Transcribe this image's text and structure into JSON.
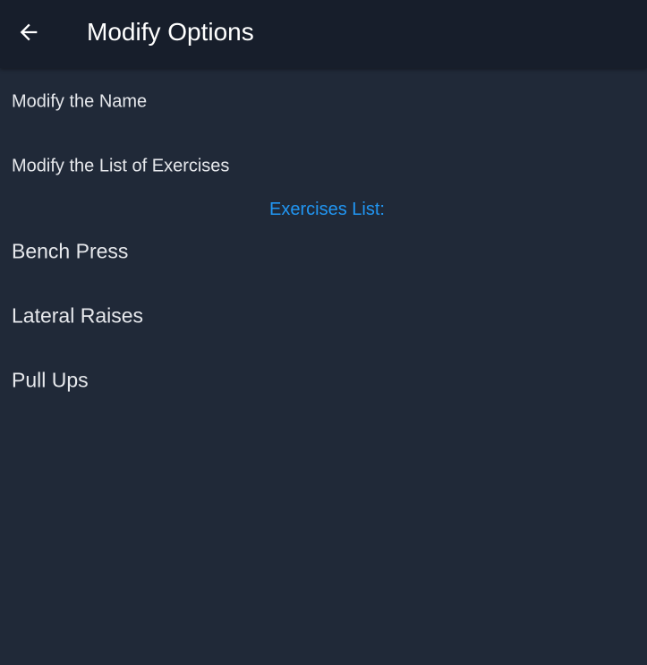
{
  "app_bar": {
    "title": "Modify Options",
    "back_icon": "arrow-back-icon"
  },
  "options": {
    "modify_name": "Modify the Name",
    "modify_list": "Modify the List of Exercises"
  },
  "exercises_section": {
    "label": "Exercises List:",
    "items": [
      "Bench Press",
      "Lateral Raises",
      "Pull Ups"
    ]
  },
  "colors": {
    "background": "#202938",
    "app_bar": "#171e2b",
    "accent": "#2196f3",
    "text": "#e6e8ec"
  }
}
